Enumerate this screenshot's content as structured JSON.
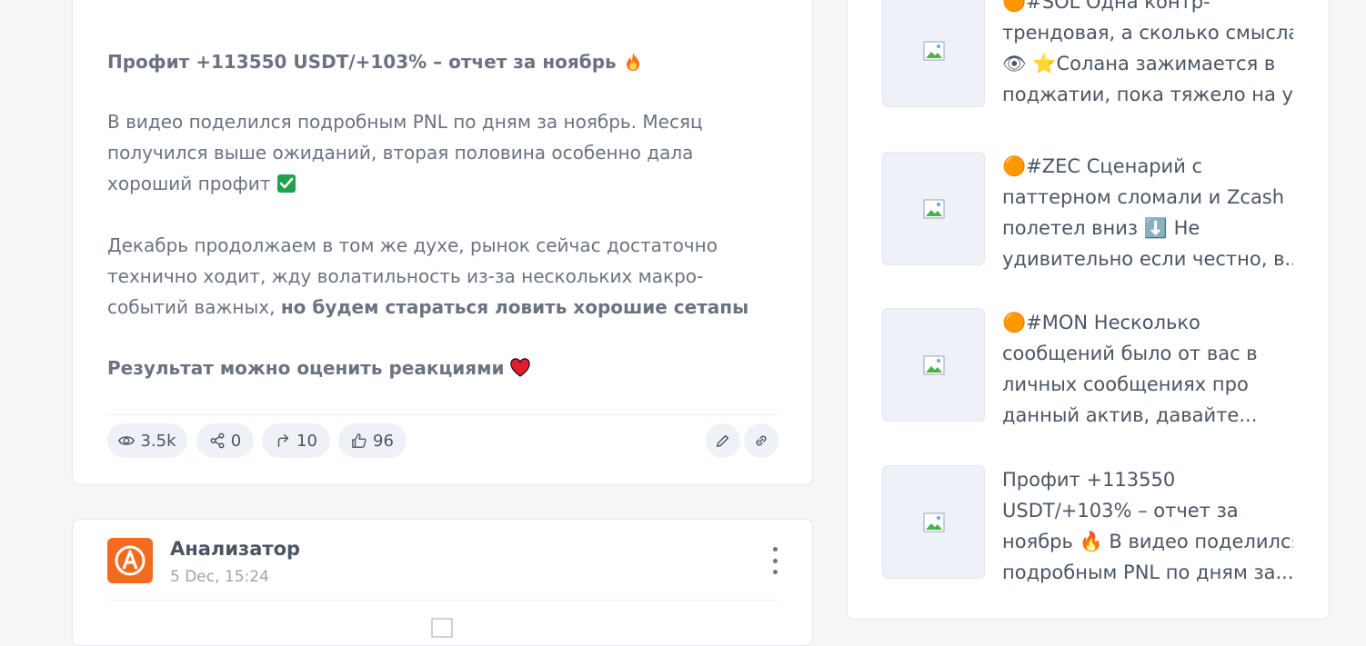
{
  "post": {
    "title": "Профит +113550 USDT/+103% – отчет за ноябрь",
    "paragraph1": "В видео поделился подробным PNL по дням за ноябрь. Месяц получился выше ожиданий, вторая половина особенно дала хороший профит",
    "paragraph2_normal": "Декабрь продолжаем в том же духе, рынок сейчас достаточно технично ходит, жду волатильность из-за нескольких макро-событий важных,",
    "paragraph2_bold": "но будем стараться ловить хорошие сетапы",
    "closing": "Результат можно оценить реакциями",
    "stats": {
      "views": "3.5k",
      "shares": "0",
      "forwards": "10",
      "likes": "96"
    }
  },
  "next_post": {
    "author": "Анализатор",
    "date": "5 Dec, 15:24"
  },
  "sidebar": {
    "items": [
      {
        "lines": [
          "🟠#SOL Одна контр-",
          "трендовая, а сколько смысла",
          "👁 ⭐Солана зажимается в",
          "поджатии, пока тяжело на у..."
        ]
      },
      {
        "lines": [
          "🟠#ZEC Сценарий с",
          "паттерном сломали и Zcash",
          "полетел вниз ⬇️ Не",
          "удивительно если честно, в..."
        ]
      },
      {
        "lines": [
          "🟠#MON Несколько",
          "сообщений было от вас в",
          "личных сообщениях про",
          "данный актив, давайте..."
        ]
      },
      {
        "lines": [
          "Профит +113550",
          "USDT/+103% – отчет за",
          "ноябрь 🔥 В видео поделился",
          "подробным PNL по дням за..."
        ]
      }
    ]
  },
  "colors": {
    "accent": "#f26b21",
    "pill_bg": "#eef1f5",
    "heart": "#e11d2e",
    "check": "#1fa34a"
  }
}
